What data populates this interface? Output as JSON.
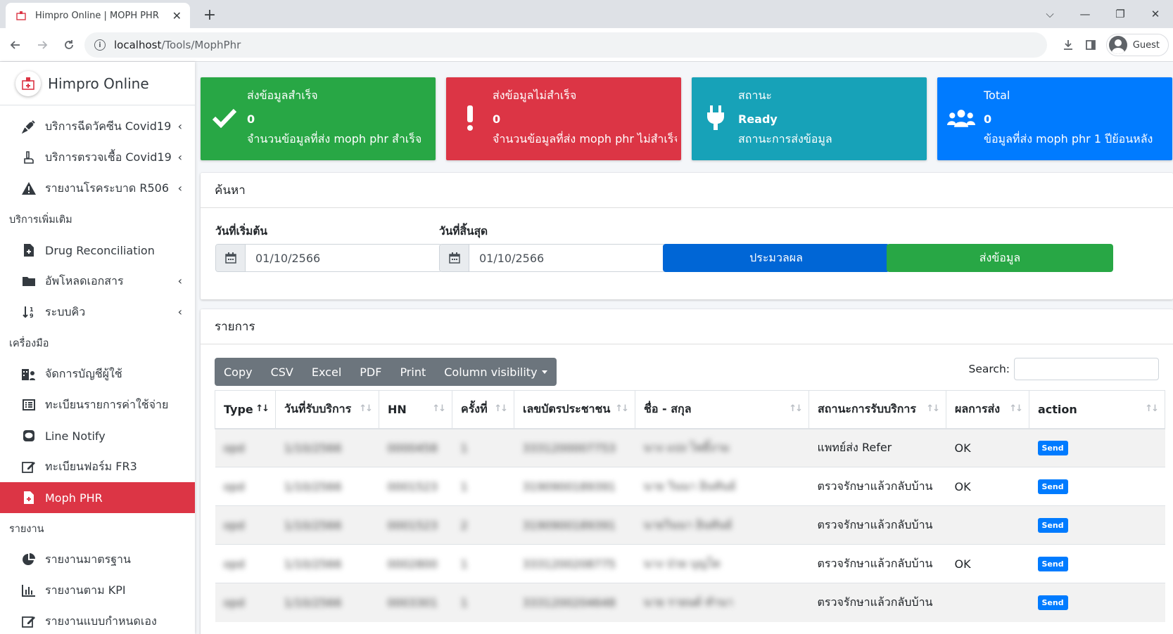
{
  "browser": {
    "tab_title": "Himpro Online | MOPH PHR",
    "tab_close": "✕",
    "new_tab": "+",
    "url_host": "localhost",
    "url_path": "/Tools/MophPhr",
    "profile": "Guest",
    "win_controls": [
      "⌵",
      "—",
      "❐",
      "✕"
    ]
  },
  "sidebar": {
    "brand": "Himpro Online",
    "items": [
      {
        "label": "บริการฉีดวัคซีน Covid19",
        "icon": "syringe-icon",
        "chevron": "‹"
      },
      {
        "label": "บริการตรวจเชื้อ Covid19",
        "icon": "hand-test-icon",
        "chevron": "‹"
      },
      {
        "label": "รายงานโรคระบาด R506",
        "icon": "warning-icon",
        "chevron": "‹"
      }
    ],
    "header_extra": "บริการเพิ่มเติม",
    "items_extra": [
      {
        "label": "Drug Reconciliation",
        "icon": "file-medical-icon"
      },
      {
        "label": "อัพโหลดเอกสาร",
        "icon": "folder-icon",
        "chevron": "‹"
      },
      {
        "label": "ระบบคิว",
        "icon": "sort-numeric-icon",
        "chevron": "‹"
      }
    ],
    "header_tools": "เครื่องมือ",
    "items_tools": [
      {
        "label": "จัดการบัญชีผู้ใช้",
        "icon": "users-building-icon"
      },
      {
        "label": "ทะเบียนรายการค่าใช้จ่าย",
        "icon": "list-icon"
      },
      {
        "label": "Line Notify",
        "icon": "line-icon"
      },
      {
        "label": "ทะเบียนฟอร์ม FR3",
        "icon": "edit-icon"
      },
      {
        "label": "Moph PHR",
        "icon": "file-medical-icon",
        "active": true
      }
    ],
    "header_reports": "รายงาน",
    "items_reports": [
      {
        "label": "รายงานมาตรฐาน",
        "icon": "pie-chart-icon"
      },
      {
        "label": "รายงานตาม KPI",
        "icon": "bar-chart-icon"
      },
      {
        "label": "รายงานแบบกำหนดเอง",
        "icon": "edit-icon"
      }
    ]
  },
  "stats": [
    {
      "title": "ส่งข้อมูลสำเร็จ",
      "value": "0",
      "desc": "จำนวนข้อมูลที่ส่ง moph phr สำเร็จ",
      "icon": "check-icon",
      "color": "#28a745"
    },
    {
      "title": "ส่งข้อมูลไม่สำเร็จ",
      "value": "0",
      "desc": "จำนวนข้อมูลที่ส่ง moph phr ไม่สำเร็จ",
      "icon": "exclamation-icon",
      "color": "#dc3545"
    },
    {
      "title": "สถานะ",
      "value": "Ready",
      "desc": "สถานะการส่งข้อมูล",
      "icon": "plug-icon",
      "color": "#17a2b8"
    },
    {
      "title": "Total",
      "value": "0",
      "desc": "ข้อมูลที่ส่ง moph phr 1 ปีย้อนหลัง",
      "icon": "users-icon",
      "color": "#007bff"
    }
  ],
  "search": {
    "title": "ค้นหา",
    "start_label": "วันที่เริ่มต้น",
    "start_value": "01/10/2566",
    "end_label": "วันที่สิ้นสุด",
    "end_value": "01/10/2566",
    "process_button": "ประมวลผล",
    "send_button": "ส่งข้อมูล"
  },
  "list": {
    "title": "รายการ",
    "buttons": [
      "Copy",
      "CSV",
      "Excel",
      "PDF",
      "Print",
      "Column visibility"
    ],
    "search_label": "Search:",
    "columns": [
      "Type",
      "วันที่รับบริการ",
      "HN",
      "ครั้งที่",
      "เลขบัตรประชาชน",
      "ชื่อ - สกุล",
      "สถานะการรับบริการ",
      "ผลการส่ง",
      "action"
    ],
    "rows": [
      {
        "type": "opd",
        "date": "1/10/2566",
        "hn": "0000458",
        "visit": "1",
        "cid": "3331200007753",
        "name": "นาง แปง ไพธิ์งาม",
        "status": "แพทย์ส่ง Refer",
        "result": "OK",
        "action": "Send"
      },
      {
        "type": "opd",
        "date": "1/10/2566",
        "hn": "0001523",
        "visit": "1",
        "cid": "3190900189391",
        "name": "นาย วินนา อินทันธ์",
        "status": "ตรวจรักษาแล้วกลับบ้าน",
        "result": "OK",
        "action": "Send"
      },
      {
        "type": "opd",
        "date": "1/10/2566",
        "hn": "0001523",
        "visit": "2",
        "cid": "3190900189391",
        "name": "นายวินนา อินทันธ์",
        "status": "ตรวจรักษาแล้วกลับบ้าน",
        "result": "",
        "action": "Send"
      },
      {
        "type": "opd",
        "date": "1/10/2566",
        "hn": "0002800",
        "visit": "1",
        "cid": "3331200208775",
        "name": "นาง ป่วย บุญโต",
        "status": "ตรวจรักษาแล้วกลับบ้าน",
        "result": "OK",
        "action": "Send"
      },
      {
        "type": "opd",
        "date": "1/10/2566",
        "hn": "0003301",
        "visit": "1",
        "cid": "3331200204648",
        "name": "นาย รายนต์ ทำนา",
        "status": "ตรวจรักษาแล้วกลับบ้าน",
        "result": "",
        "action": "Send"
      }
    ]
  }
}
